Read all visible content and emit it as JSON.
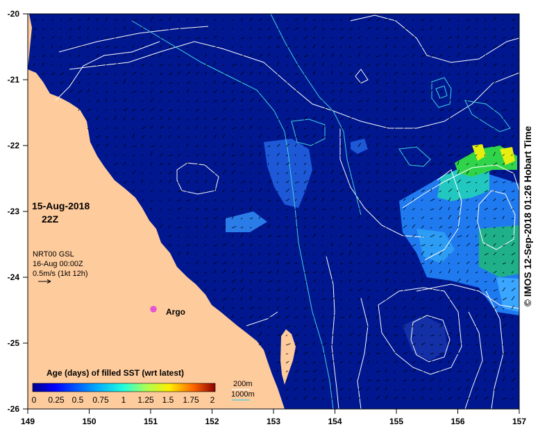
{
  "map": {
    "date": "15-Aug-2018",
    "hour": "22Z",
    "current_source": "NRT00 GSL",
    "current_time": "16-Aug 00:00Z",
    "current_scale": "0.5m/s (1kt 12h)",
    "float_label": "Argo",
    "colorbar_title": "Age (days) of filled SST (wrt latest)",
    "colorbar_ticks": [
      "0",
      "0.25",
      "0.5",
      "0.75",
      "1",
      "1.25",
      "1.5",
      "1.75",
      "2"
    ],
    "contour_legend": [
      "200m",
      "1000m"
    ],
    "credit": "© IMOS 12-Sep-2018 01:26 Hobart Time",
    "lon_ticks": [
      "149",
      "150",
      "151",
      "152",
      "153",
      "154",
      "155",
      "156",
      "157"
    ],
    "lat_ticks": [
      "-20",
      "-21",
      "-22",
      "-23",
      "-24",
      "-25",
      "-26"
    ],
    "lon_range": [
      149,
      157
    ],
    "lat_range": [
      -26,
      -20
    ],
    "argo_position": {
      "lon": 151.0,
      "lat": -24.5
    }
  },
  "colors": {
    "ocean": "#00178f",
    "land": "#fecb9c",
    "contour_200m": "#ffffff",
    "contour_1000m": "#43d3e0",
    "argo": "#e23ae0"
  }
}
